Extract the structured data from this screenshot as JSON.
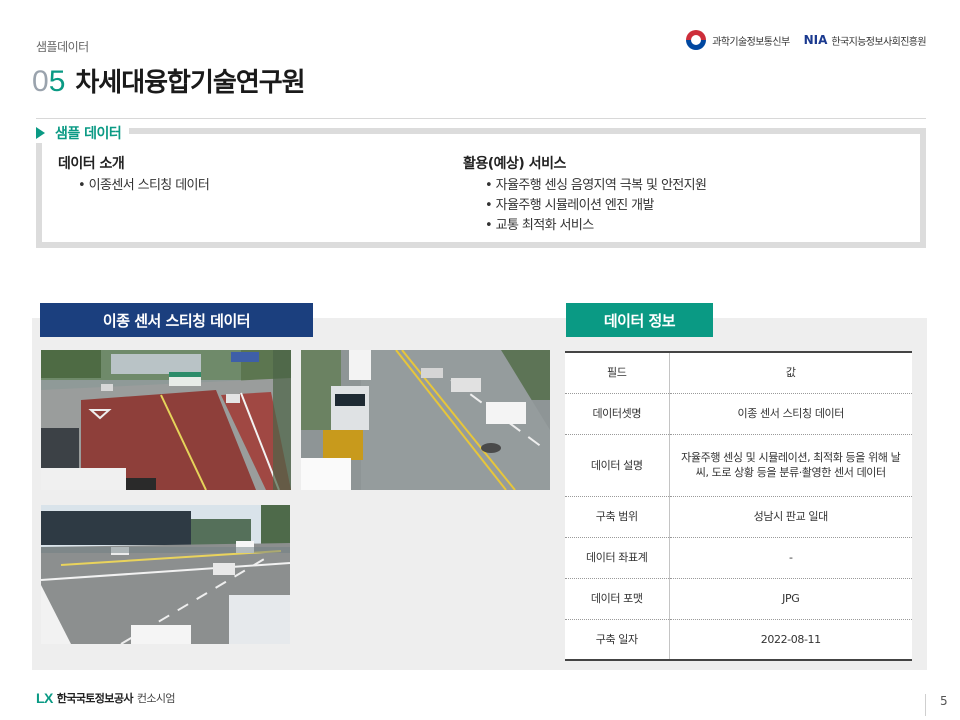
{
  "header": {
    "breadcrumb": "샘플데이터",
    "logo_msit": "과학기술정보통신부",
    "logo_nia_mark": "NIA",
    "logo_nia_text": "한국지능정보사회진흥원"
  },
  "title": {
    "num_prefix": "0",
    "num_accent": "5",
    "text": "차세대융합기술연구원"
  },
  "sample": {
    "heading": "샘플 데이터",
    "intro_heading": "데이터 소개",
    "intro_items": [
      "이종센서 스티칭 데이터"
    ],
    "use_heading": "활용(예상) 서비스",
    "use_items": [
      "자율주행 센싱 음영지역 극복 및 안전지원",
      "자율주행 시뮬레이션 엔진 개발",
      "교통 최적화 서비스"
    ]
  },
  "left_panel": {
    "tab_label": "이종 센서 스티칭 데이터"
  },
  "right_panel": {
    "tab_label": "데이터 정보",
    "table": {
      "header": [
        "필드",
        "값"
      ],
      "rows": [
        [
          "데이터셋명",
          "이종 센서 스티칭 데이터"
        ],
        [
          "데이터 설명",
          "자율주행 센싱 및 시뮬레이션, 최적화 등을 위해 날씨, 도로 상황 등을 분류·촬영한 센서 데이터"
        ],
        [
          "구축 범위",
          "성남시 판교 일대"
        ],
        [
          "데이터 좌표계",
          "-"
        ],
        [
          "데이터 포맷",
          "JPG"
        ],
        [
          "구축 일자",
          "2022-08-11"
        ]
      ]
    }
  },
  "footer": {
    "logo_mark": "LX",
    "logo_text": "한국국토정보공사",
    "logo_sub": "컨소시엄",
    "page_number": "5"
  },
  "colors": {
    "accent_green": "#0a9a84",
    "navy": "#1b3f7e"
  }
}
